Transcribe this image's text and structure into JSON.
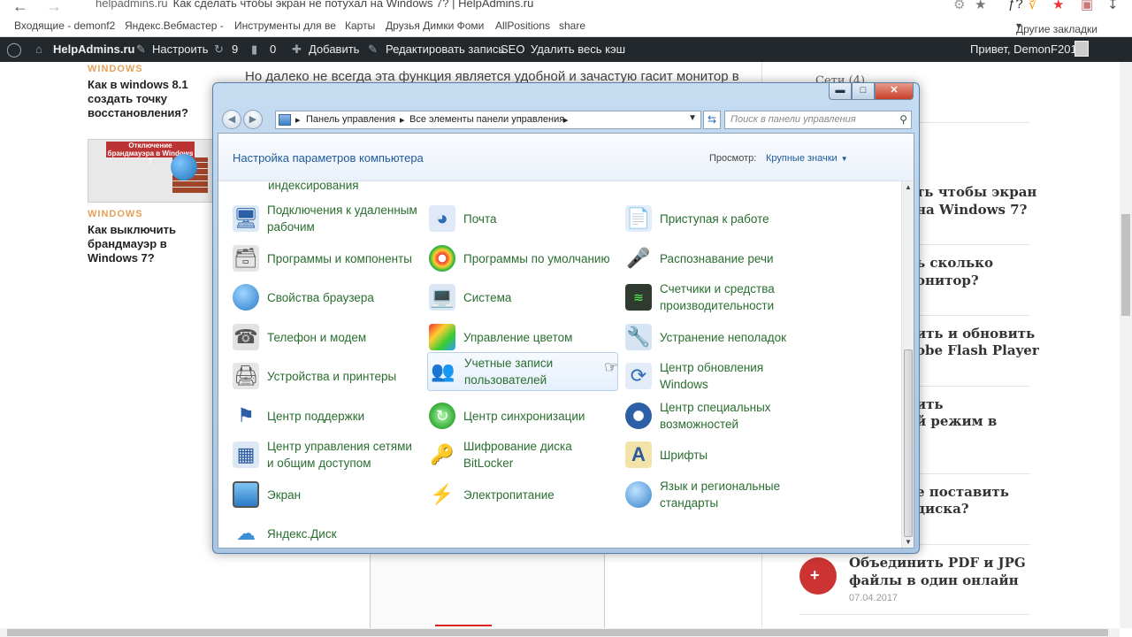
{
  "browser": {
    "url": "helpadmins.ru",
    "tab_title": "Как сделать чтобы экран не потухал на Windows 7? | HelpAdmins.ru",
    "bookmarks": [
      "Входящие - demonf2",
      "Яндекс.Вебмастер - ",
      "Инструменты для ве",
      "Карты",
      "Друзья Димки Фоми",
      "AllPositions",
      "share"
    ],
    "other_bookmarks": "Другие закладки"
  },
  "wpbar": {
    "site": "HelpAdmins.ru",
    "customize": "Настроить",
    "updates": "9",
    "comments": "0",
    "add": "Добавить",
    "edit": "Редактировать запись",
    "seo": "SEO",
    "purge": "Удалить весь кэш",
    "greeting": "Привет, DemonF2016"
  },
  "page": {
    "left": [
      {
        "category": "WINDOWS",
        "title": "Как в windows 8.1 создать точку восстановления?"
      },
      {
        "category": "WINDOWS",
        "title": "Как выключить брандмауэр в Windows 7?"
      }
    ],
    "thumb_caption": "Отключение брандмауэра в Windows 7",
    "bg_text": "Но далеко не всегда эта функция является удобной и зачастую гасит монитор в",
    "right": [
      {
        "title": "ть чтобы экран"
      },
      {
        "title": "на Windows 7?"
      },
      {
        "title": "ь сколько"
      },
      {
        "title": "онитор?"
      },
      {
        "title": "ить и обновить"
      },
      {
        "title": "obe Flash Player"
      },
      {
        "title": "ить"
      },
      {
        "title": "й режим в"
      },
      {
        "title": "е поставить"
      },
      {
        "title": "диска?"
      },
      {
        "title": "Объединить PDF и JPG"
      },
      {
        "title": "файлы в один онлайн"
      }
    ],
    "last_date": "07.04.2017",
    "right_partial_top": "Сети (4)"
  },
  "window": {
    "breadcrumb": [
      "Панель управления",
      "Все элементы панели управления"
    ],
    "search_placeholder": "Поиск в панели управления",
    "header_title": "Настройка параметров компьютера",
    "view_label": "Просмотр:",
    "view_value": "Крупные значки",
    "cut_top": [
      "индексирования"
    ],
    "items": [
      {
        "label": "Подключения к удаленным рабочим",
        "icon": "remote-desktop-icon"
      },
      {
        "label": "Почта",
        "icon": "mail-icon"
      },
      {
        "label": "Приступая к работе",
        "icon": "getting-started-icon"
      },
      {
        "label": "Программы и компоненты",
        "icon": "programs-icon"
      },
      {
        "label": "Программы по умолчанию",
        "icon": "default-programs-icon"
      },
      {
        "label": "Распознавание речи",
        "icon": "microphone-icon"
      },
      {
        "label": "Свойства браузера",
        "icon": "browser-options-icon"
      },
      {
        "label": "Система",
        "icon": "system-icon"
      },
      {
        "label": "Счетчики и средства производительности",
        "icon": "performance-icon"
      },
      {
        "label": "Телефон и модем",
        "icon": "phone-modem-icon"
      },
      {
        "label": "Управление цветом",
        "icon": "color-management-icon"
      },
      {
        "label": "Устранение неполадок",
        "icon": "troubleshooting-icon"
      },
      {
        "label": "Устройства и принтеры",
        "icon": "printer-icon"
      },
      {
        "label": "Учетные записи пользователей",
        "icon": "user-accounts-icon"
      },
      {
        "label": "Центр обновления Windows",
        "icon": "windows-update-icon"
      },
      {
        "label": "Центр поддержки",
        "icon": "action-center-flag-icon"
      },
      {
        "label": "Центр синхронизации",
        "icon": "sync-center-icon"
      },
      {
        "label": "Центр специальных возможностей",
        "icon": "ease-of-access-icon"
      },
      {
        "label": "Центр управления сетями и общим доступом",
        "icon": "network-center-icon"
      },
      {
        "label": "Шифрование диска BitLocker",
        "icon": "bitlocker-icon"
      },
      {
        "label": "Шрифты",
        "icon": "fonts-icon"
      },
      {
        "label": "Экран",
        "icon": "display-icon"
      },
      {
        "label": "Электропитание",
        "icon": "power-options-icon"
      },
      {
        "label": "Язык и региональные стандарты",
        "icon": "region-language-icon"
      },
      {
        "label": "Яндекс.Диск",
        "icon": "yandex-disk-icon"
      }
    ]
  }
}
